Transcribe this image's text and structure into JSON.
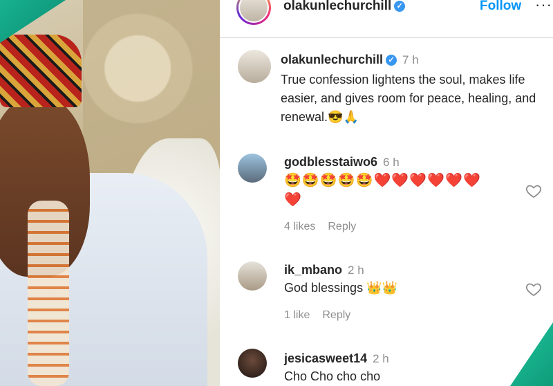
{
  "header": {
    "username": "olakunlechurchill",
    "follow_label": "Follow",
    "more_label": "···"
  },
  "caption": {
    "username": "olakunlechurchill",
    "time": "7 h",
    "text": "True confession lightens the soul, makes life easier, and gives room for peace, healing, and renewal.😎🙏"
  },
  "comments": [
    {
      "username": "godblesstaiwo6",
      "time": "6 h",
      "text_line1": "🤩🤩🤩🤩🤩❤️❤️❤️❤️❤️❤️",
      "text_line2": "❤️",
      "likes": "4 likes",
      "reply": "Reply"
    },
    {
      "username": "ik_mbano",
      "time": "2 h",
      "text": "God blessings 👑👑",
      "likes": "1 like",
      "reply": "Reply"
    },
    {
      "username": "jesicasweet14",
      "time": "2 h",
      "text": "Cho Cho cho cho"
    }
  ],
  "colors": {
    "accent": "#0095f6",
    "verified": "#3897f0",
    "muted": "#8e8e8e",
    "text": "#262626",
    "overlay": "#17b28f"
  }
}
